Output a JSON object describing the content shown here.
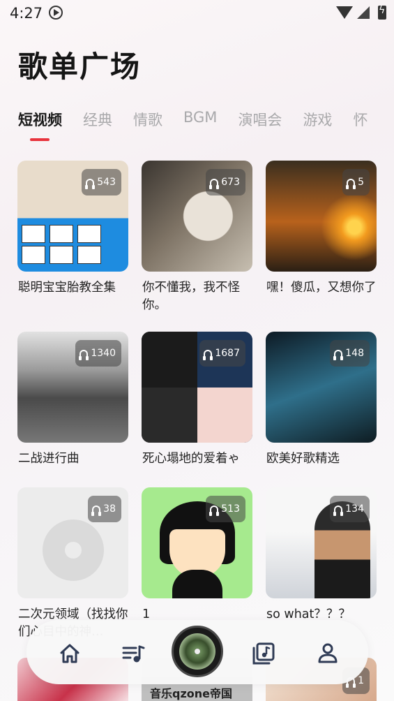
{
  "status_bar": {
    "time": "4:27"
  },
  "header": {
    "title": "歌单广场"
  },
  "tabs": [
    {
      "label": "短视频",
      "active": true
    },
    {
      "label": "经典"
    },
    {
      "label": "情歌"
    },
    {
      "label": "BGM"
    },
    {
      "label": "演唱会"
    },
    {
      "label": "游戏"
    },
    {
      "label": "怀"
    }
  ],
  "playlists": [
    {
      "title": "聪明宝宝胎教全集",
      "plays": "543"
    },
    {
      "title": "你不懂我，我不怪你。",
      "plays": "673"
    },
    {
      "title": "嘿！傻瓜，又想你了",
      "plays": "5"
    },
    {
      "title": "二战进行曲",
      "plays": "1340"
    },
    {
      "title": "死心塌地的爱着ゃ",
      "plays": "1687"
    },
    {
      "title": "欧美好歌精选",
      "plays": "148"
    },
    {
      "title": "二次元领域（找找你们心目中的神…",
      "plays": "38"
    },
    {
      "title": "1",
      "plays": "513"
    },
    {
      "title": "so what？？？",
      "plays": "134"
    }
  ],
  "peek_row": {
    "badge_right": "1",
    "cover_text_mid": "音乐qzone帝国"
  },
  "bottom_nav": {
    "items": [
      {
        "name": "home",
        "icon": "home-icon"
      },
      {
        "name": "playlist",
        "icon": "playlist-icon"
      },
      {
        "name": "now-playing",
        "icon": "disc-icon"
      },
      {
        "name": "library",
        "icon": "music-library-icon"
      },
      {
        "name": "profile",
        "icon": "person-icon"
      }
    ]
  },
  "colors": {
    "accent": "#e8333c",
    "tab_inactive": "#a9a9ab",
    "nav_icon": "#2f3b55"
  }
}
